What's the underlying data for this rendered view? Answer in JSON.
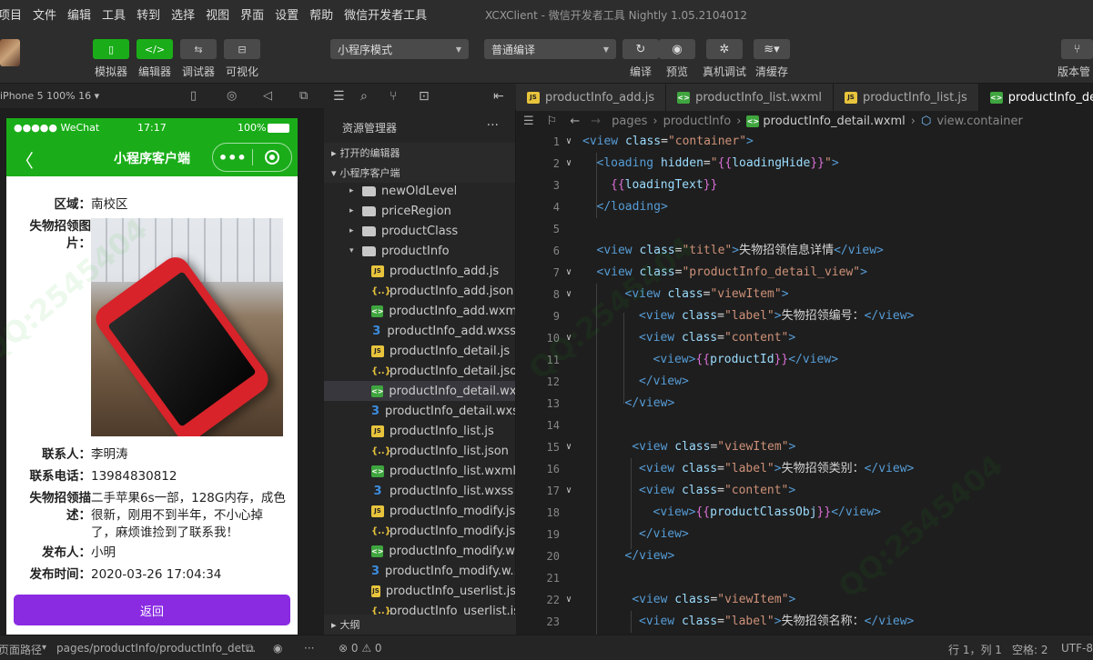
{
  "menu": [
    "项目",
    "文件",
    "编辑",
    "工具",
    "转到",
    "选择",
    "视图",
    "界面",
    "设置",
    "帮助",
    "微信开发者工具"
  ],
  "window_title": "XCXClient - 微信开发者工具 Nightly 1.05.2104012",
  "toolbar": {
    "simulator": "模拟器",
    "editor": "编辑器",
    "debugger": "调试器",
    "visual": "可视化",
    "mode": "小程序模式",
    "compile": "普通编译",
    "compile_btn": "编译",
    "preview": "预览",
    "remote_debug": "真机调试",
    "clear_cache": "清缓存",
    "version": "版本管"
  },
  "simulator": {
    "device": "iPhone 5 100% 16",
    "status": {
      "carrier": "●●●●● WeChat",
      "time": "17:17",
      "battery": "100%"
    },
    "title": "小程序客户端",
    "fields": [
      {
        "label": "区域：",
        "value": "南校区"
      },
      {
        "label": "失物招领图片：",
        "value": ""
      },
      {
        "label": "联系人：",
        "value": "李明涛"
      },
      {
        "label": "联系电话：",
        "value": "13984830812"
      },
      {
        "label": "失物招领描述：",
        "value": "二手苹果6s一部，128G内存，成色很新，刚用不到半年，不小心掉了，麻烦谁捡到了联系我！"
      },
      {
        "label": "发布人：",
        "value": "小明"
      },
      {
        "label": "发布时间：",
        "value": "2020-03-26 17:04:34"
      }
    ],
    "back_button": "返回"
  },
  "explorer": {
    "header": "资源管理器",
    "open_editors": "打开的编辑器",
    "project": "小程序客户端",
    "folders": [
      "newOldLevel",
      "priceRegion",
      "productClass",
      "productInfo"
    ],
    "files": [
      {
        "name": "productInfo_add.js",
        "type": "js"
      },
      {
        "name": "productInfo_add.json",
        "type": "json"
      },
      {
        "name": "productInfo_add.wxml",
        "type": "wxml"
      },
      {
        "name": "productInfo_add.wxss",
        "type": "wxss"
      },
      {
        "name": "productInfo_detail.js",
        "type": "js"
      },
      {
        "name": "productInfo_detail.json",
        "type": "json"
      },
      {
        "name": "productInfo_detail.wx...",
        "type": "wxml"
      },
      {
        "name": "productInfo_detail.wxss",
        "type": "wxss"
      },
      {
        "name": "productInfo_list.js",
        "type": "js"
      },
      {
        "name": "productInfo_list.json",
        "type": "json"
      },
      {
        "name": "productInfo_list.wxml",
        "type": "wxml"
      },
      {
        "name": "productInfo_list.wxss",
        "type": "wxss"
      },
      {
        "name": "productInfo_modify.js",
        "type": "js"
      },
      {
        "name": "productInfo_modify.js...",
        "type": "json"
      },
      {
        "name": "productInfo_modify.w...",
        "type": "wxml"
      },
      {
        "name": "productInfo_modify.w...",
        "type": "wxss"
      },
      {
        "name": "productInfo_userlist.js",
        "type": "js"
      },
      {
        "name": "productInfo_userlist.is...",
        "type": "json"
      }
    ],
    "outline": "大纲"
  },
  "tabs": [
    {
      "name": "productInfo_add.js",
      "type": "js"
    },
    {
      "name": "productInfo_list.wxml",
      "type": "wxml"
    },
    {
      "name": "productInfo_list.js",
      "type": "js"
    },
    {
      "name": "productInfo_deta",
      "type": "wxml"
    }
  ],
  "breadcrumb": [
    "pages",
    "productInfo",
    "productInfo_detail.wxml",
    "view.container"
  ],
  "code_lines": [
    {
      "n": "1",
      "fold": true,
      "indent": 0,
      "html": "<span class='tag'>&lt;view</span> <span class='att'>class</span>=<span class='str'>\"container\"</span><span class='tag'>&gt;</span>"
    },
    {
      "n": "2",
      "fold": true,
      "indent": 1,
      "html": "<span class='tag'>&lt;loading</span> <span class='att'>hidden</span>=<span class='str'>\"</span><span class='br'>{{</span><span class='att'>loadingHide</span><span class='br'>}}</span><span class='str'>\"</span><span class='tag'>&gt;</span>"
    },
    {
      "n": "3",
      "fold": false,
      "indent": 2,
      "html": "<span class='br'>{{</span><span class='att'>loadingText</span><span class='br'>}}</span>"
    },
    {
      "n": "4",
      "fold": false,
      "indent": 1,
      "html": "<span class='tag'>&lt;/loading&gt;</span>"
    },
    {
      "n": "5",
      "fold": false,
      "indent": 0,
      "html": ""
    },
    {
      "n": "6",
      "fold": false,
      "indent": 1,
      "html": "<span class='tag'>&lt;view</span> <span class='att'>class</span>=<span class='str'>\"title\"</span><span class='tag'>&gt;</span><span class='txt'>失物招领信息详情</span><span class='tag'>&lt;/view&gt;</span>"
    },
    {
      "n": "7",
      "fold": true,
      "indent": 1,
      "html": "<span class='tag'>&lt;view</span> <span class='att'>class</span>=<span class='str'>\"productInfo_detail_view\"</span><span class='tag'>&gt;</span>"
    },
    {
      "n": "8",
      "fold": true,
      "indent": 3,
      "html": "<span class='tag'>&lt;view</span> <span class='att'>class</span>=<span class='str'>\"viewItem\"</span><span class='tag'>&gt;</span>"
    },
    {
      "n": "9",
      "fold": false,
      "indent": 4,
      "html": "<span class='tag'>&lt;view</span> <span class='att'>class</span>=<span class='str'>\"label\"</span><span class='tag'>&gt;</span><span class='txt'>失物招领编号：</span><span class='tag'>&lt;/view&gt;</span>"
    },
    {
      "n": "10",
      "fold": true,
      "indent": 4,
      "html": "<span class='tag'>&lt;view</span> <span class='att'>class</span>=<span class='str'>\"content\"</span><span class='tag'>&gt;</span>"
    },
    {
      "n": "11",
      "fold": false,
      "indent": 5,
      "html": "<span class='tag'>&lt;view&gt;</span><span class='br'>{{</span><span class='att'>productId</span><span class='br'>}}</span><span class='tag'>&lt;/view&gt;</span>"
    },
    {
      "n": "12",
      "fold": false,
      "indent": 4,
      "html": "<span class='tag'>&lt;/view&gt;</span>"
    },
    {
      "n": "13",
      "fold": false,
      "indent": 3,
      "html": "<span class='tag'>&lt;/view&gt;</span>"
    },
    {
      "n": "14",
      "fold": false,
      "indent": 0,
      "html": ""
    },
    {
      "n": "15",
      "fold": true,
      "indent": 3,
      "html": " <span class='tag'>&lt;view</span> <span class='att'>class</span>=<span class='str'>\"viewItem\"</span><span class='tag'>&gt;</span>"
    },
    {
      "n": "16",
      "fold": false,
      "indent": 4,
      "html": "<span class='tag'>&lt;view</span> <span class='att'>class</span>=<span class='str'>\"label\"</span><span class='tag'>&gt;</span><span class='txt'>失物招领类别：</span><span class='tag'>&lt;/view&gt;</span>"
    },
    {
      "n": "17",
      "fold": true,
      "indent": 4,
      "html": "<span class='tag'>&lt;view</span> <span class='att'>class</span>=<span class='str'>\"content\"</span><span class='tag'>&gt;</span>"
    },
    {
      "n": "18",
      "fold": false,
      "indent": 5,
      "html": "<span class='tag'>&lt;view&gt;</span><span class='br'>{{</span><span class='att'>productClassObj</span><span class='br'>}}</span><span class='tag'>&lt;/view&gt;</span>"
    },
    {
      "n": "19",
      "fold": false,
      "indent": 4,
      "html": "<span class='tag'>&lt;/view&gt;</span>"
    },
    {
      "n": "20",
      "fold": false,
      "indent": 3,
      "html": "<span class='tag'>&lt;/view&gt;</span>"
    },
    {
      "n": "21",
      "fold": false,
      "indent": 0,
      "html": ""
    },
    {
      "n": "22",
      "fold": true,
      "indent": 3,
      "html": " <span class='tag'>&lt;view</span> <span class='att'>class</span>=<span class='str'>\"viewItem\"</span><span class='tag'>&gt;</span>"
    },
    {
      "n": "23",
      "fold": false,
      "indent": 4,
      "html": "<span class='tag'>&lt;view</span> <span class='att'>class</span>=<span class='str'>\"label\"</span><span class='tag'>&gt;</span><span class='txt'>失物招领名称：</span><span class='tag'>&lt;/view&gt;</span>"
    }
  ],
  "status": {
    "path_label": "页面路径",
    "path": "pages/productInfo/productInfo_det...",
    "problems": "⊗ 0 ⚠ 0",
    "cursor": "行 1，列 1",
    "spaces": "空格: 2",
    "encoding": "UTF-8"
  },
  "watermark": "QQ:2545404"
}
